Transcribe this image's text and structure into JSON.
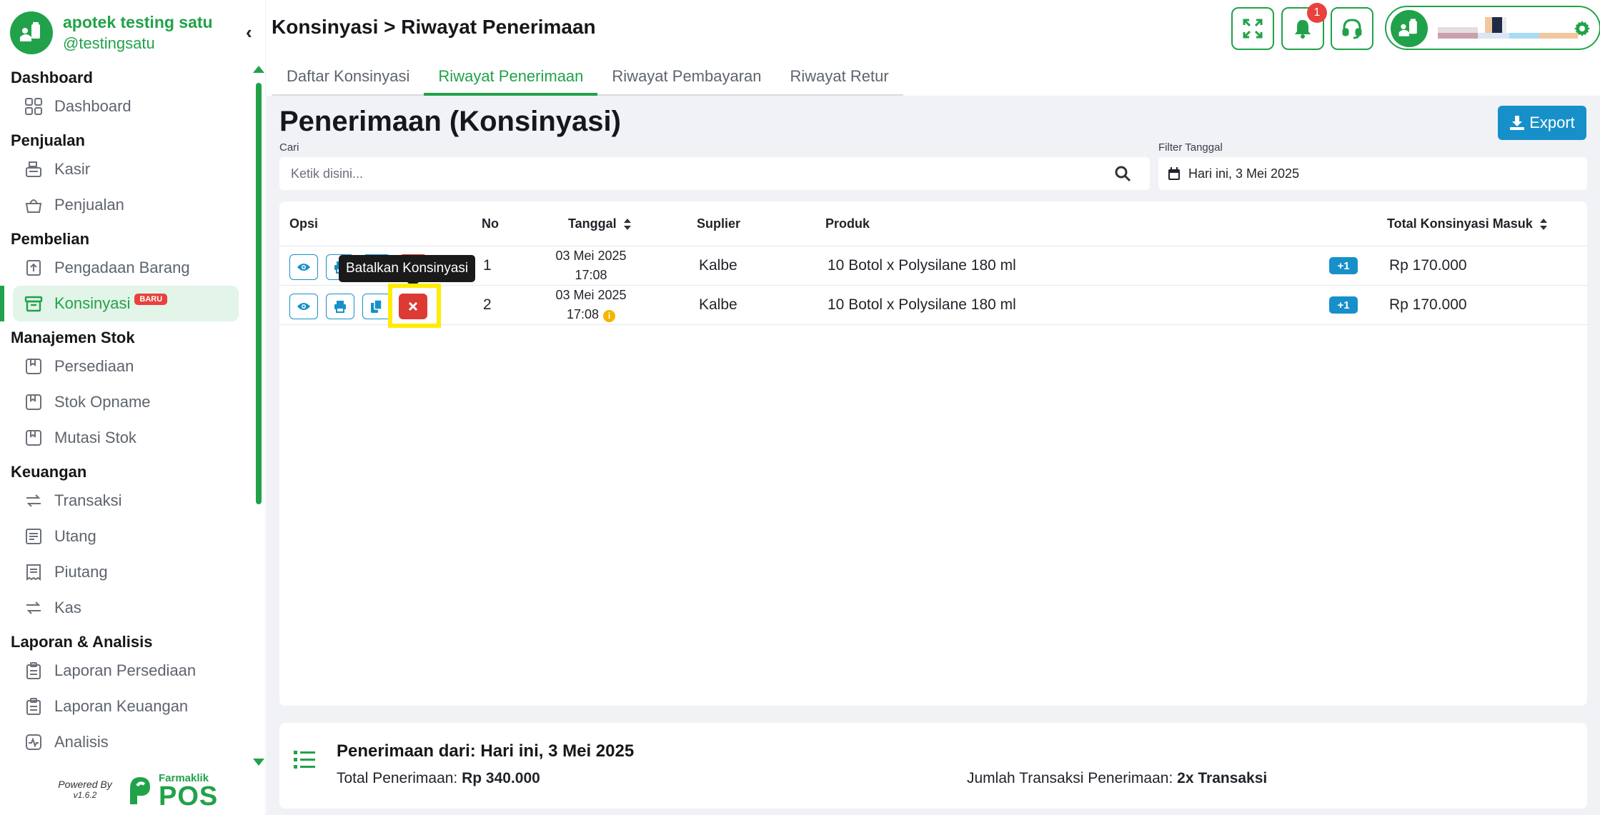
{
  "brand": {
    "name": "apotek testing satu",
    "handle": "@testingsatu"
  },
  "sidebar": {
    "sections": [
      {
        "title": "Dashboard",
        "items": [
          {
            "label": "Dashboard",
            "icon": "grid-icon"
          }
        ]
      },
      {
        "title": "Penjualan",
        "items": [
          {
            "label": "Kasir",
            "icon": "cash-register-icon"
          },
          {
            "label": "Penjualan",
            "icon": "basket-icon"
          }
        ]
      },
      {
        "title": "Pembelian",
        "items": [
          {
            "label": "Pengadaan Barang",
            "icon": "receipt-upload-icon"
          },
          {
            "label": "Konsinyasi",
            "icon": "archive-box-icon",
            "active": true,
            "badge": "BARU"
          }
        ]
      },
      {
        "title": "Manajemen Stok",
        "items": [
          {
            "label": "Persediaan",
            "icon": "bookmark-box-icon"
          },
          {
            "label": "Stok Opname",
            "icon": "bookmark-box-icon"
          },
          {
            "label": "Mutasi Stok",
            "icon": "bookmark-box-icon"
          }
        ]
      },
      {
        "title": "Keuangan",
        "items": [
          {
            "label": "Transaksi",
            "icon": "swap-arrows-icon"
          },
          {
            "label": "Utang",
            "icon": "document-lines-icon"
          },
          {
            "label": "Piutang",
            "icon": "receipt-icon"
          },
          {
            "label": "Kas",
            "icon": "swap-arrows-icon"
          }
        ]
      },
      {
        "title": "Laporan & Analisis",
        "items": [
          {
            "label": "Laporan Persediaan",
            "icon": "clipboard-icon"
          },
          {
            "label": "Laporan Keuangan",
            "icon": "clipboard-icon"
          },
          {
            "label": "Analisis",
            "icon": "activity-chart-icon"
          }
        ]
      }
    ]
  },
  "footer": {
    "powered_by": "Powered By",
    "version": "v1.6.2",
    "logo_small": "Farmaklik",
    "logo_big": "POS"
  },
  "header": {
    "breadcrumb": "Konsinyasi > Riwayat Penerimaan",
    "notification_count": "1"
  },
  "tabs": [
    {
      "label": "Daftar Konsinyasi",
      "active": false
    },
    {
      "label": "Riwayat Penerimaan",
      "active": true
    },
    {
      "label": "Riwayat Pembayaran",
      "active": false
    },
    {
      "label": "Riwayat Retur",
      "active": false
    }
  ],
  "page": {
    "title": "Penerimaan (Konsinyasi)",
    "export_label": "Export",
    "search_label": "Cari",
    "search_placeholder": "Ketik disini...",
    "filter_label": "Filter Tanggal",
    "filter_value": "Hari ini, 3 Mei 2025"
  },
  "table": {
    "headers": {
      "opsi": "Opsi",
      "no": "No",
      "tanggal": "Tanggal",
      "suplier": "Suplier",
      "produk": "Produk",
      "total": "Total Konsinyasi Masuk"
    },
    "rows": [
      {
        "no": "1",
        "date": "03 Mei 2025",
        "time": "17:08",
        "supplier": "Kalbe",
        "product": "10 Botol x Polysilane 180 ml",
        "extra": "+1",
        "total": "Rp 170.000"
      },
      {
        "no": "2",
        "date": "03 Mei 2025",
        "time": "17:08",
        "supplier": "Kalbe",
        "product": "10 Botol x Polysilane 180 ml",
        "extra": "+1",
        "total": "Rp 170.000"
      }
    ]
  },
  "tooltip": "Batalkan Konsinyasi",
  "summary": {
    "title": "Penerimaan dari: Hari ini, 3 Mei 2025",
    "total_label": "Total Penerimaan:",
    "total_value": "Rp 340.000",
    "count_label": "Jumlah Transaksi Penerimaan:",
    "count_value": "2x Transaksi"
  },
  "colors": {
    "brand_green": "#21a24a",
    "action_blue": "#1790c9",
    "danger_red": "#dc3a35",
    "highlight_yellow": "#ffec00"
  }
}
